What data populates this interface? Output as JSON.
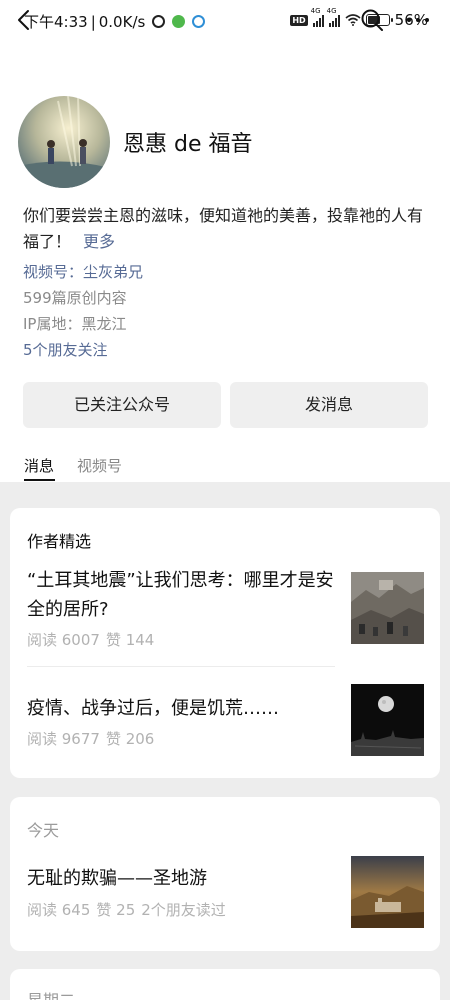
{
  "status_bar": {
    "time": "下午4:33",
    "speed": "0.0K/s",
    "network_1": "4G",
    "network_2": "4G",
    "hd": "HD",
    "battery": "56%"
  },
  "account": {
    "name": "恩惠 de 福音",
    "bio": "你们要尝尝主恩的滋味，便知道祂的美善，投靠祂的人有福了！",
    "bio_more": "更多",
    "channel": "视频号：尘灰弟兄",
    "original_count": "599篇原创内容",
    "ip": "IP属地：黑龙江",
    "friends_follow": "5个朋友关注"
  },
  "buttons": {
    "follow": "已关注公众号",
    "message": "发消息"
  },
  "tabs": [
    "消息",
    "视频号"
  ],
  "featured": {
    "title": "作者精选",
    "articles": [
      {
        "title": "“土耳其地震”让我们思考：哪里才是安全的居所?",
        "read": "阅读 6007",
        "likes": "赞 144"
      },
      {
        "title": "疫情、战争过后，便是饥荒……",
        "read": "阅读 9677",
        "likes": "赞 206"
      }
    ]
  },
  "today": {
    "label": "今天",
    "articles": [
      {
        "title": "无耻的欺骗——圣地游",
        "read": "阅读 645",
        "likes": "赞 25",
        "friends": "2个朋友读过"
      }
    ]
  },
  "next_section": {
    "label": "星期二"
  },
  "colors": {
    "link": "#576b95",
    "background": "#ededed",
    "card": "#ffffff"
  }
}
